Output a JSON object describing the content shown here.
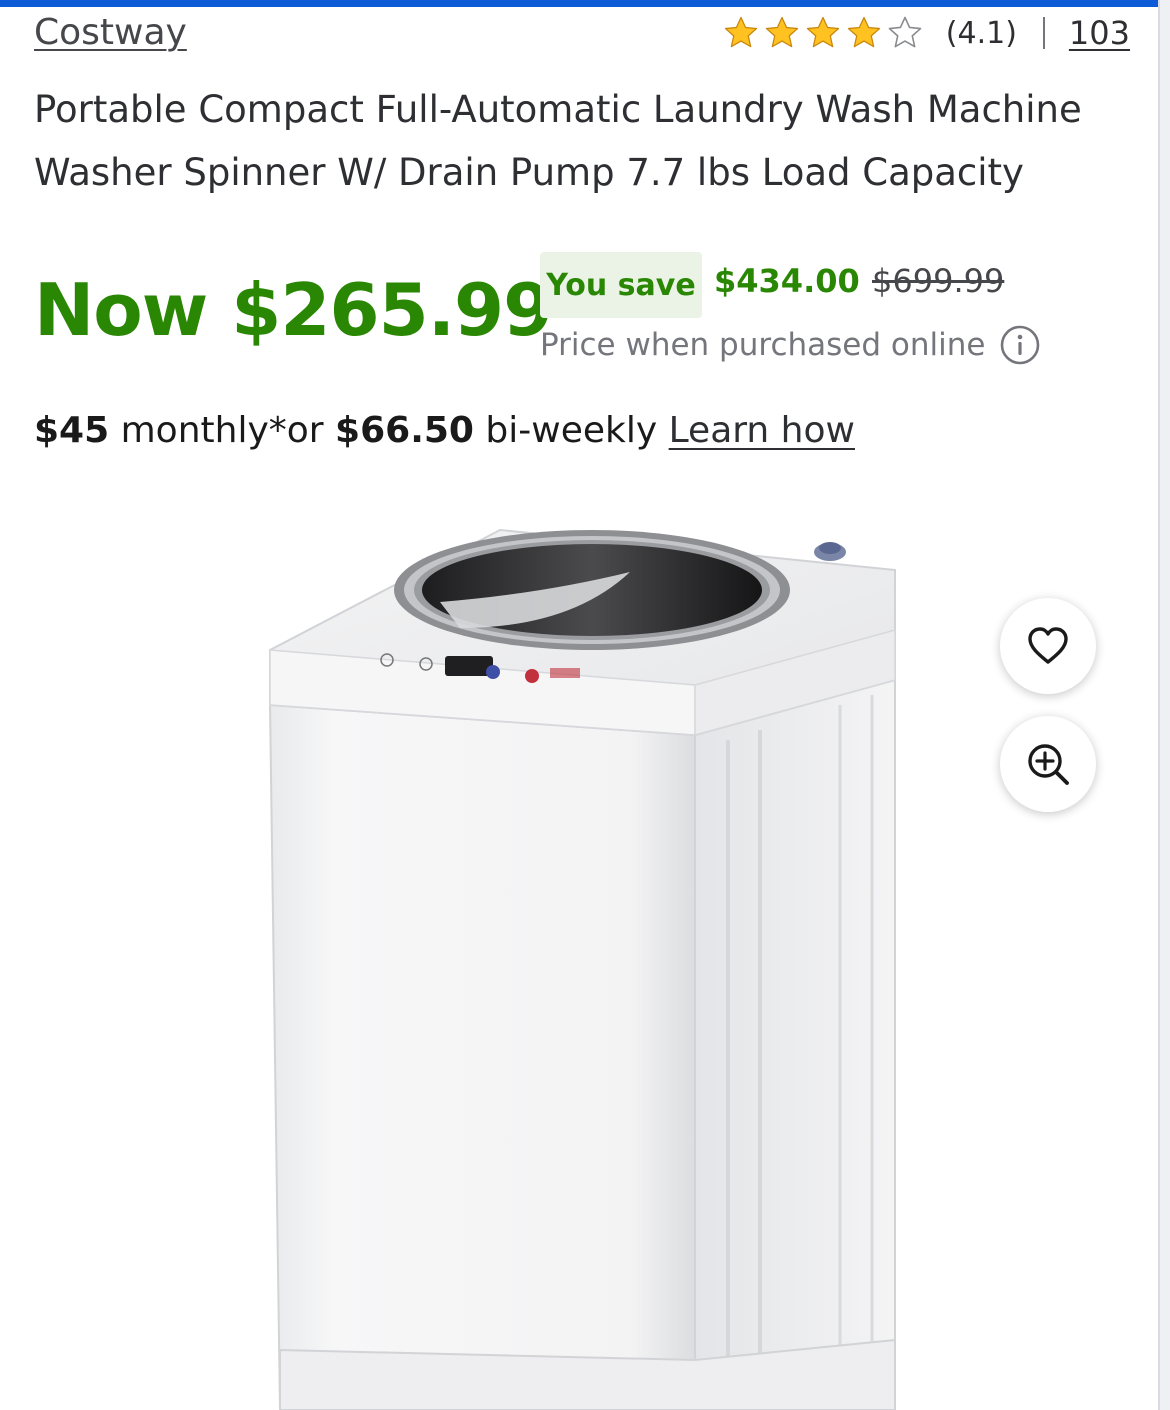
{
  "brand": "Costway",
  "rating": {
    "value_text": "(4.1)",
    "value": 4.1,
    "max": 5,
    "review_count": "103"
  },
  "product_title": "Portable Compact Full-Automatic Laundry Wash Machine Washer Spinner W/ Drain Pump 7.7 lbs Load Capacity",
  "pricing": {
    "now_label": "Now $265.99",
    "you_save_label": "You save",
    "save_amount": "$434.00",
    "was_price": "$699.99",
    "note": "Price when purchased online"
  },
  "financing": {
    "monthly_amount": "$45",
    "monthly_text": "monthly*or",
    "biweekly_amount": "$66.50",
    "biweekly_text": "bi-weekly",
    "link": "Learn how"
  },
  "icons": {
    "star": "star-icon",
    "info": "info-icon",
    "favorite": "heart-icon",
    "zoom": "zoom-in-icon"
  },
  "colors": {
    "accent_blue": "#0e5bd8",
    "price_green": "#2a8703",
    "save_chip_bg": "#eaf3e6",
    "star_gold": "#ffc220",
    "muted_text": "#74767c"
  }
}
